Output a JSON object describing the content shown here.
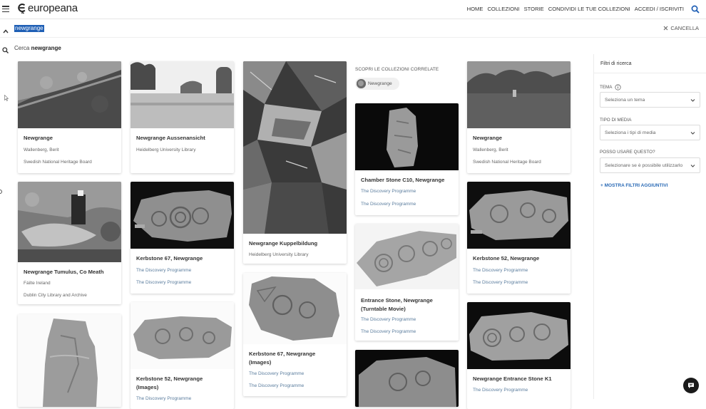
{
  "brand": {
    "name": "europeana",
    "accent": "#1f5fb5"
  },
  "nav": {
    "items": [
      "HOME",
      "COLLEZIONI",
      "STORIE",
      "CONDIVIDI LE TUE COLLEZIONI",
      "ACCEDI / ISCRIVITI"
    ]
  },
  "query": {
    "value": "newgrange",
    "cancel_label": "CANCELLA"
  },
  "suggestion": {
    "prefix": "Cerca",
    "term": "newgrange"
  },
  "related": {
    "heading": "SCOPRI LE COLLEZIONI CORRELATE",
    "chip": "Newgrange"
  },
  "filters": {
    "heading": "Filtri di ricerca",
    "theme_label": "TEMA",
    "theme_placeholder": "Seleziona un tema",
    "media_label": "TIPO DI MEDIA",
    "media_placeholder": "Seleziona i tipi di media",
    "usage_label": "POSSO USARE QUESTO?",
    "usage_placeholder": "Selezionare se è possibile utilizzarlo",
    "more_label": "+ MOSTRA FILTRI AGGIUNTIVI"
  },
  "results": [
    {
      "title": "Newgrange",
      "creator": "Wallenberg, Berit",
      "provider": "Swedish National Heritage Board"
    },
    {
      "title": "Newgrange Tumulus, Co Meath",
      "creator": "Fáilte Ireland",
      "provider": "Dublin City Library and Archive"
    },
    {
      "title": "Newgrange Aussenansicht",
      "provider": "Heidelberg University Library"
    },
    {
      "title": "Kerbstone 67, Newgrange",
      "creator": "The Discovery Programme",
      "provider": "The Discovery Programme"
    },
    {
      "title": "Kerbstone 52, Newgrange (Images)",
      "creator": "The Discovery Programme"
    },
    {
      "title": "Newgrange Kuppelbildung",
      "provider": "Heidelberg University Library"
    },
    {
      "title": "Kerbstone 67, Newgrange (Images)",
      "creator": "The Discovery Programme",
      "provider": "The Discovery Programme"
    },
    {
      "title": "Chamber Stone C10, Newgrange",
      "creator": "The Discovery Programme",
      "provider": "The Discovery Programme"
    },
    {
      "title": "Entrance Stone, Newgrange (Turntable Movie)",
      "creator": "The Discovery Programme",
      "provider": "The Discovery Programme"
    },
    {
      "title": "Newgrange",
      "creator": "Wallenberg, Berit",
      "provider": "Swedish National Heritage Board"
    },
    {
      "title": "Kerbstone 52, Newgrange",
      "creator": "The Discovery Programme",
      "provider": "The Discovery Programme"
    },
    {
      "title": "Newgrange Entrance Stone K1",
      "creator": "The Discovery Programme"
    }
  ]
}
